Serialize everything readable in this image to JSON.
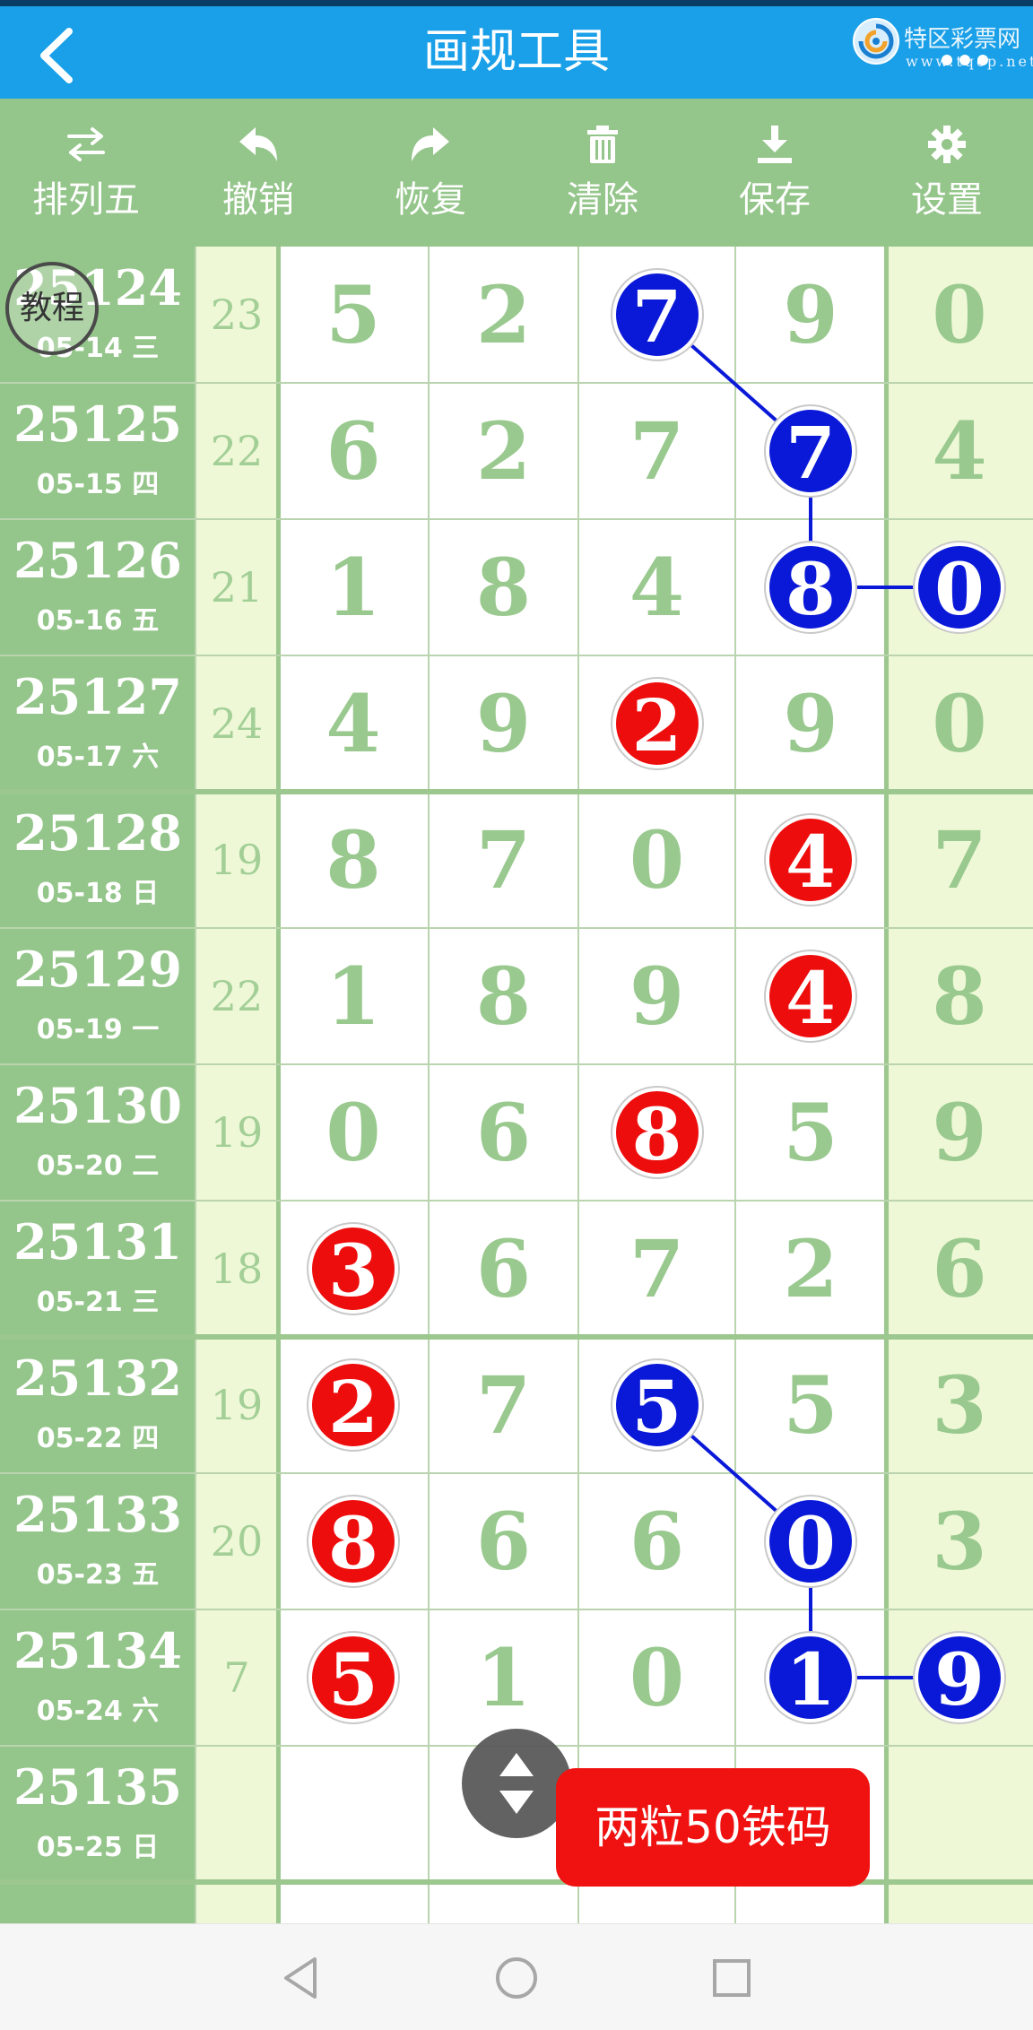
{
  "header": {
    "title": "画规工具",
    "brand_name": "特区彩票网",
    "brand_url": "www.tqcp.net"
  },
  "toolbar": [
    {
      "name": "mode",
      "label": "排列五",
      "icon": "swap-icon"
    },
    {
      "name": "undo",
      "label": "撤销",
      "icon": "undo-icon"
    },
    {
      "name": "redo",
      "label": "恢复",
      "icon": "redo-icon"
    },
    {
      "name": "clear",
      "label": "清除",
      "icon": "trash-icon"
    },
    {
      "name": "save",
      "label": "保存",
      "icon": "download-icon"
    },
    {
      "name": "settings",
      "label": "设置",
      "icon": "gear-icon"
    }
  ],
  "rows": [
    {
      "issue": "25124",
      "date": "05-14 三",
      "sum": "23",
      "digits": [
        "5",
        "2",
        "7",
        "9",
        "0"
      ]
    },
    {
      "issue": "25125",
      "date": "05-15 四",
      "sum": "22",
      "digits": [
        "6",
        "2",
        "7",
        "7",
        "4"
      ]
    },
    {
      "issue": "25126",
      "date": "05-16 五",
      "sum": "21",
      "digits": [
        "1",
        "8",
        "4",
        "8",
        "0"
      ]
    },
    {
      "issue": "25127",
      "date": "05-17 六",
      "sum": "24",
      "digits": [
        "4",
        "9",
        "2",
        "9",
        "0"
      ]
    },
    {
      "issue": "25128",
      "date": "05-18 日",
      "sum": "19",
      "digits": [
        "8",
        "7",
        "0",
        "4",
        "7"
      ]
    },
    {
      "issue": "25129",
      "date": "05-19 一",
      "sum": "22",
      "digits": [
        "1",
        "8",
        "9",
        "4",
        "8"
      ]
    },
    {
      "issue": "25130",
      "date": "05-20 二",
      "sum": "19",
      "digits": [
        "0",
        "6",
        "8",
        "5",
        "9"
      ]
    },
    {
      "issue": "25131",
      "date": "05-21 三",
      "sum": "18",
      "digits": [
        "3",
        "6",
        "7",
        "2",
        "6"
      ]
    },
    {
      "issue": "25132",
      "date": "05-22 四",
      "sum": "19",
      "digits": [
        "2",
        "7",
        "5",
        "5",
        "3"
      ]
    },
    {
      "issue": "25133",
      "date": "05-23 五",
      "sum": "20",
      "digits": [
        "8",
        "6",
        "6",
        "0",
        "3"
      ]
    },
    {
      "issue": "25134",
      "date": "05-24 六",
      "sum": "7",
      "digits": [
        "5",
        "1",
        "0",
        "1",
        "9"
      ]
    },
    {
      "issue": "25135",
      "date": "05-25 日",
      "sum": "",
      "digits": [
        "",
        "",
        "",
        "",
        ""
      ]
    }
  ],
  "marks": [
    {
      "row": 0,
      "col": 2,
      "color": "blue"
    },
    {
      "row": 1,
      "col": 3,
      "color": "blue"
    },
    {
      "row": 2,
      "col": 3,
      "color": "blue"
    },
    {
      "row": 2,
      "col": 4,
      "color": "blue"
    },
    {
      "row": 3,
      "col": 2,
      "color": "red"
    },
    {
      "row": 4,
      "col": 3,
      "color": "red"
    },
    {
      "row": 5,
      "col": 3,
      "color": "red"
    },
    {
      "row": 6,
      "col": 2,
      "color": "red"
    },
    {
      "row": 7,
      "col": 0,
      "color": "red"
    },
    {
      "row": 8,
      "col": 0,
      "color": "red"
    },
    {
      "row": 8,
      "col": 2,
      "color": "blue"
    },
    {
      "row": 9,
      "col": 0,
      "color": "red"
    },
    {
      "row": 9,
      "col": 3,
      "color": "blue"
    },
    {
      "row": 10,
      "col": 0,
      "color": "red"
    },
    {
      "row": 10,
      "col": 3,
      "color": "blue"
    },
    {
      "row": 10,
      "col": 4,
      "color": "blue"
    }
  ],
  "links": [
    [
      [
        0,
        2
      ],
      [
        1,
        3
      ],
      [
        2,
        3
      ],
      [
        2,
        4
      ]
    ],
    [
      [
        8,
        2
      ],
      [
        9,
        3
      ],
      [
        10,
        3
      ],
      [
        10,
        4
      ]
    ]
  ],
  "colors": {
    "blue": "#0a19d8",
    "red": "#ee0d0d",
    "line": "#0a19d8"
  },
  "stamp_label": "教程",
  "promo_label": "两粒50铁码"
}
